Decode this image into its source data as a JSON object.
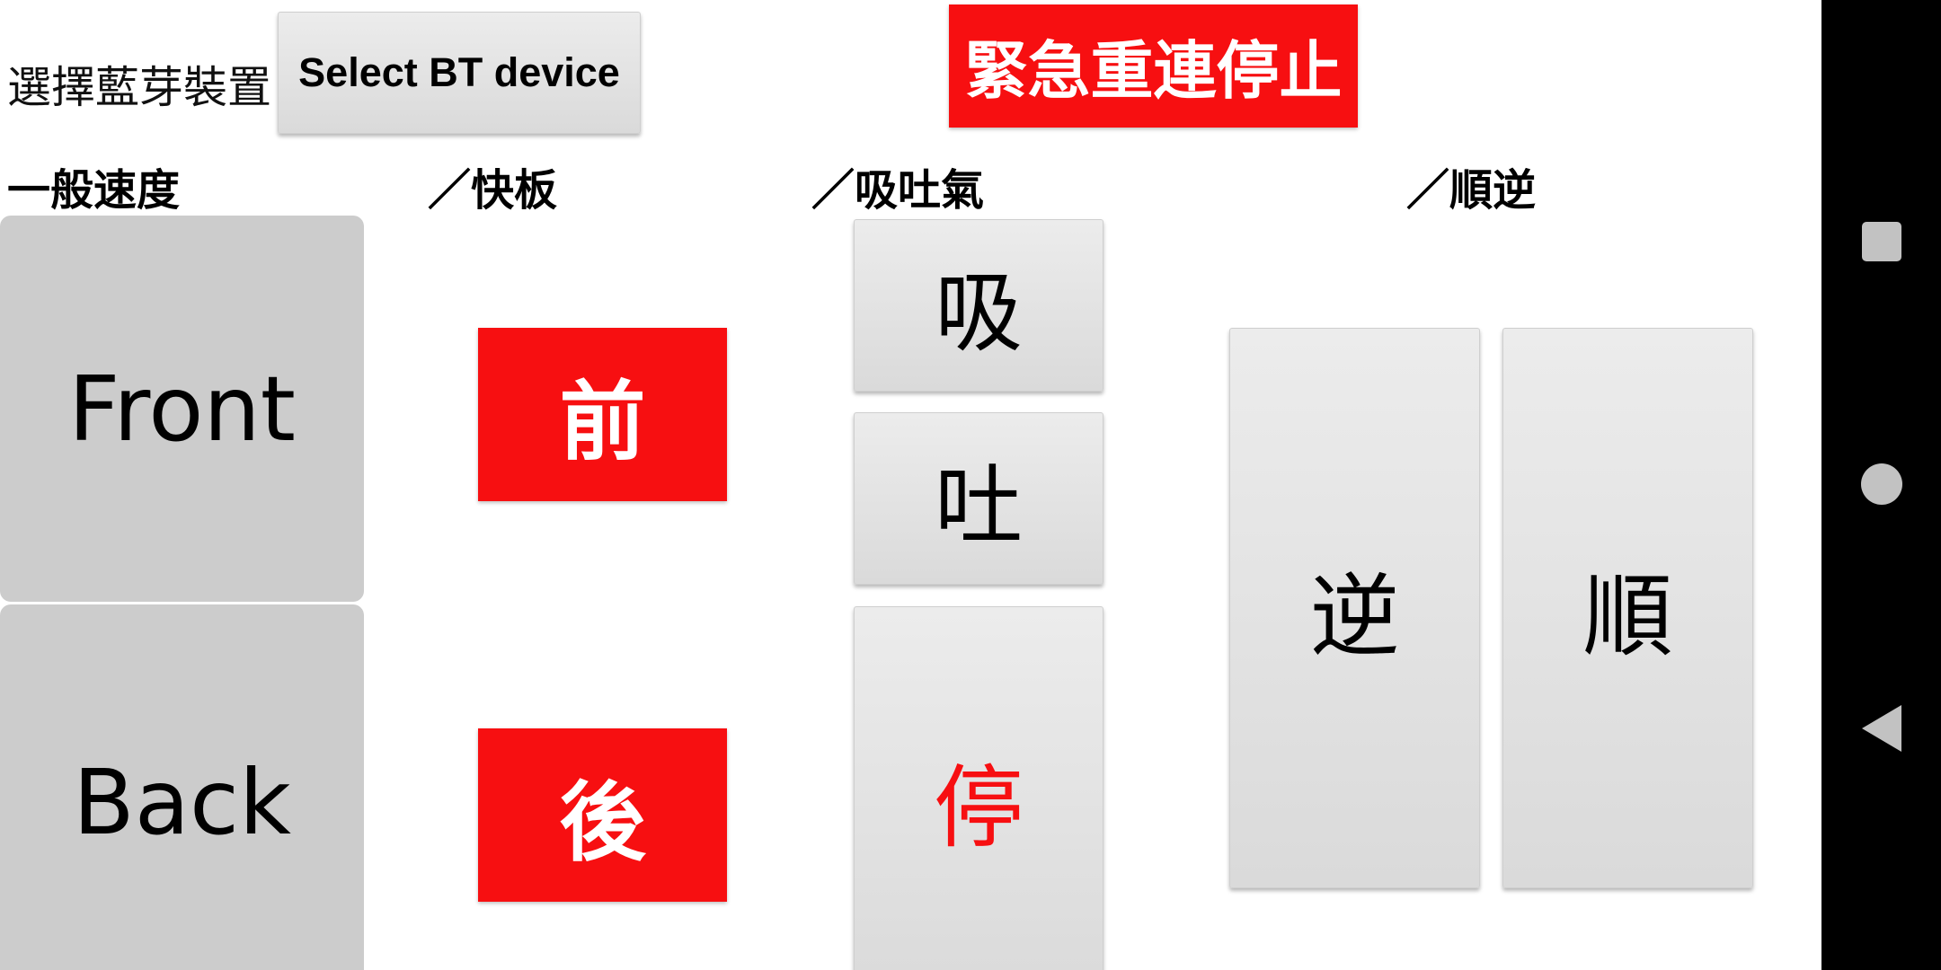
{
  "top_bar": {
    "bt_label": "選擇藍芽裝置",
    "select_bt_button": "Select BT device",
    "emergency_button": "緊急重連停止"
  },
  "headings": {
    "normal_speed": "一般速度",
    "skateboard": "／快板",
    "breath": "／吸吐氣",
    "direction": "／順逆"
  },
  "controls": {
    "front": "Front",
    "back": "Back",
    "forward": "前",
    "reverse": "後",
    "inhale": "吸",
    "exhale": "吐",
    "stop": "停",
    "counterclockwise": "逆",
    "clockwise": "順"
  },
  "colors": {
    "accent_red": "#f70f11",
    "flat_gray": "#cccccc"
  },
  "navbar": {
    "recents": "square-icon",
    "home": "circle-icon",
    "back": "triangle-back-icon"
  }
}
